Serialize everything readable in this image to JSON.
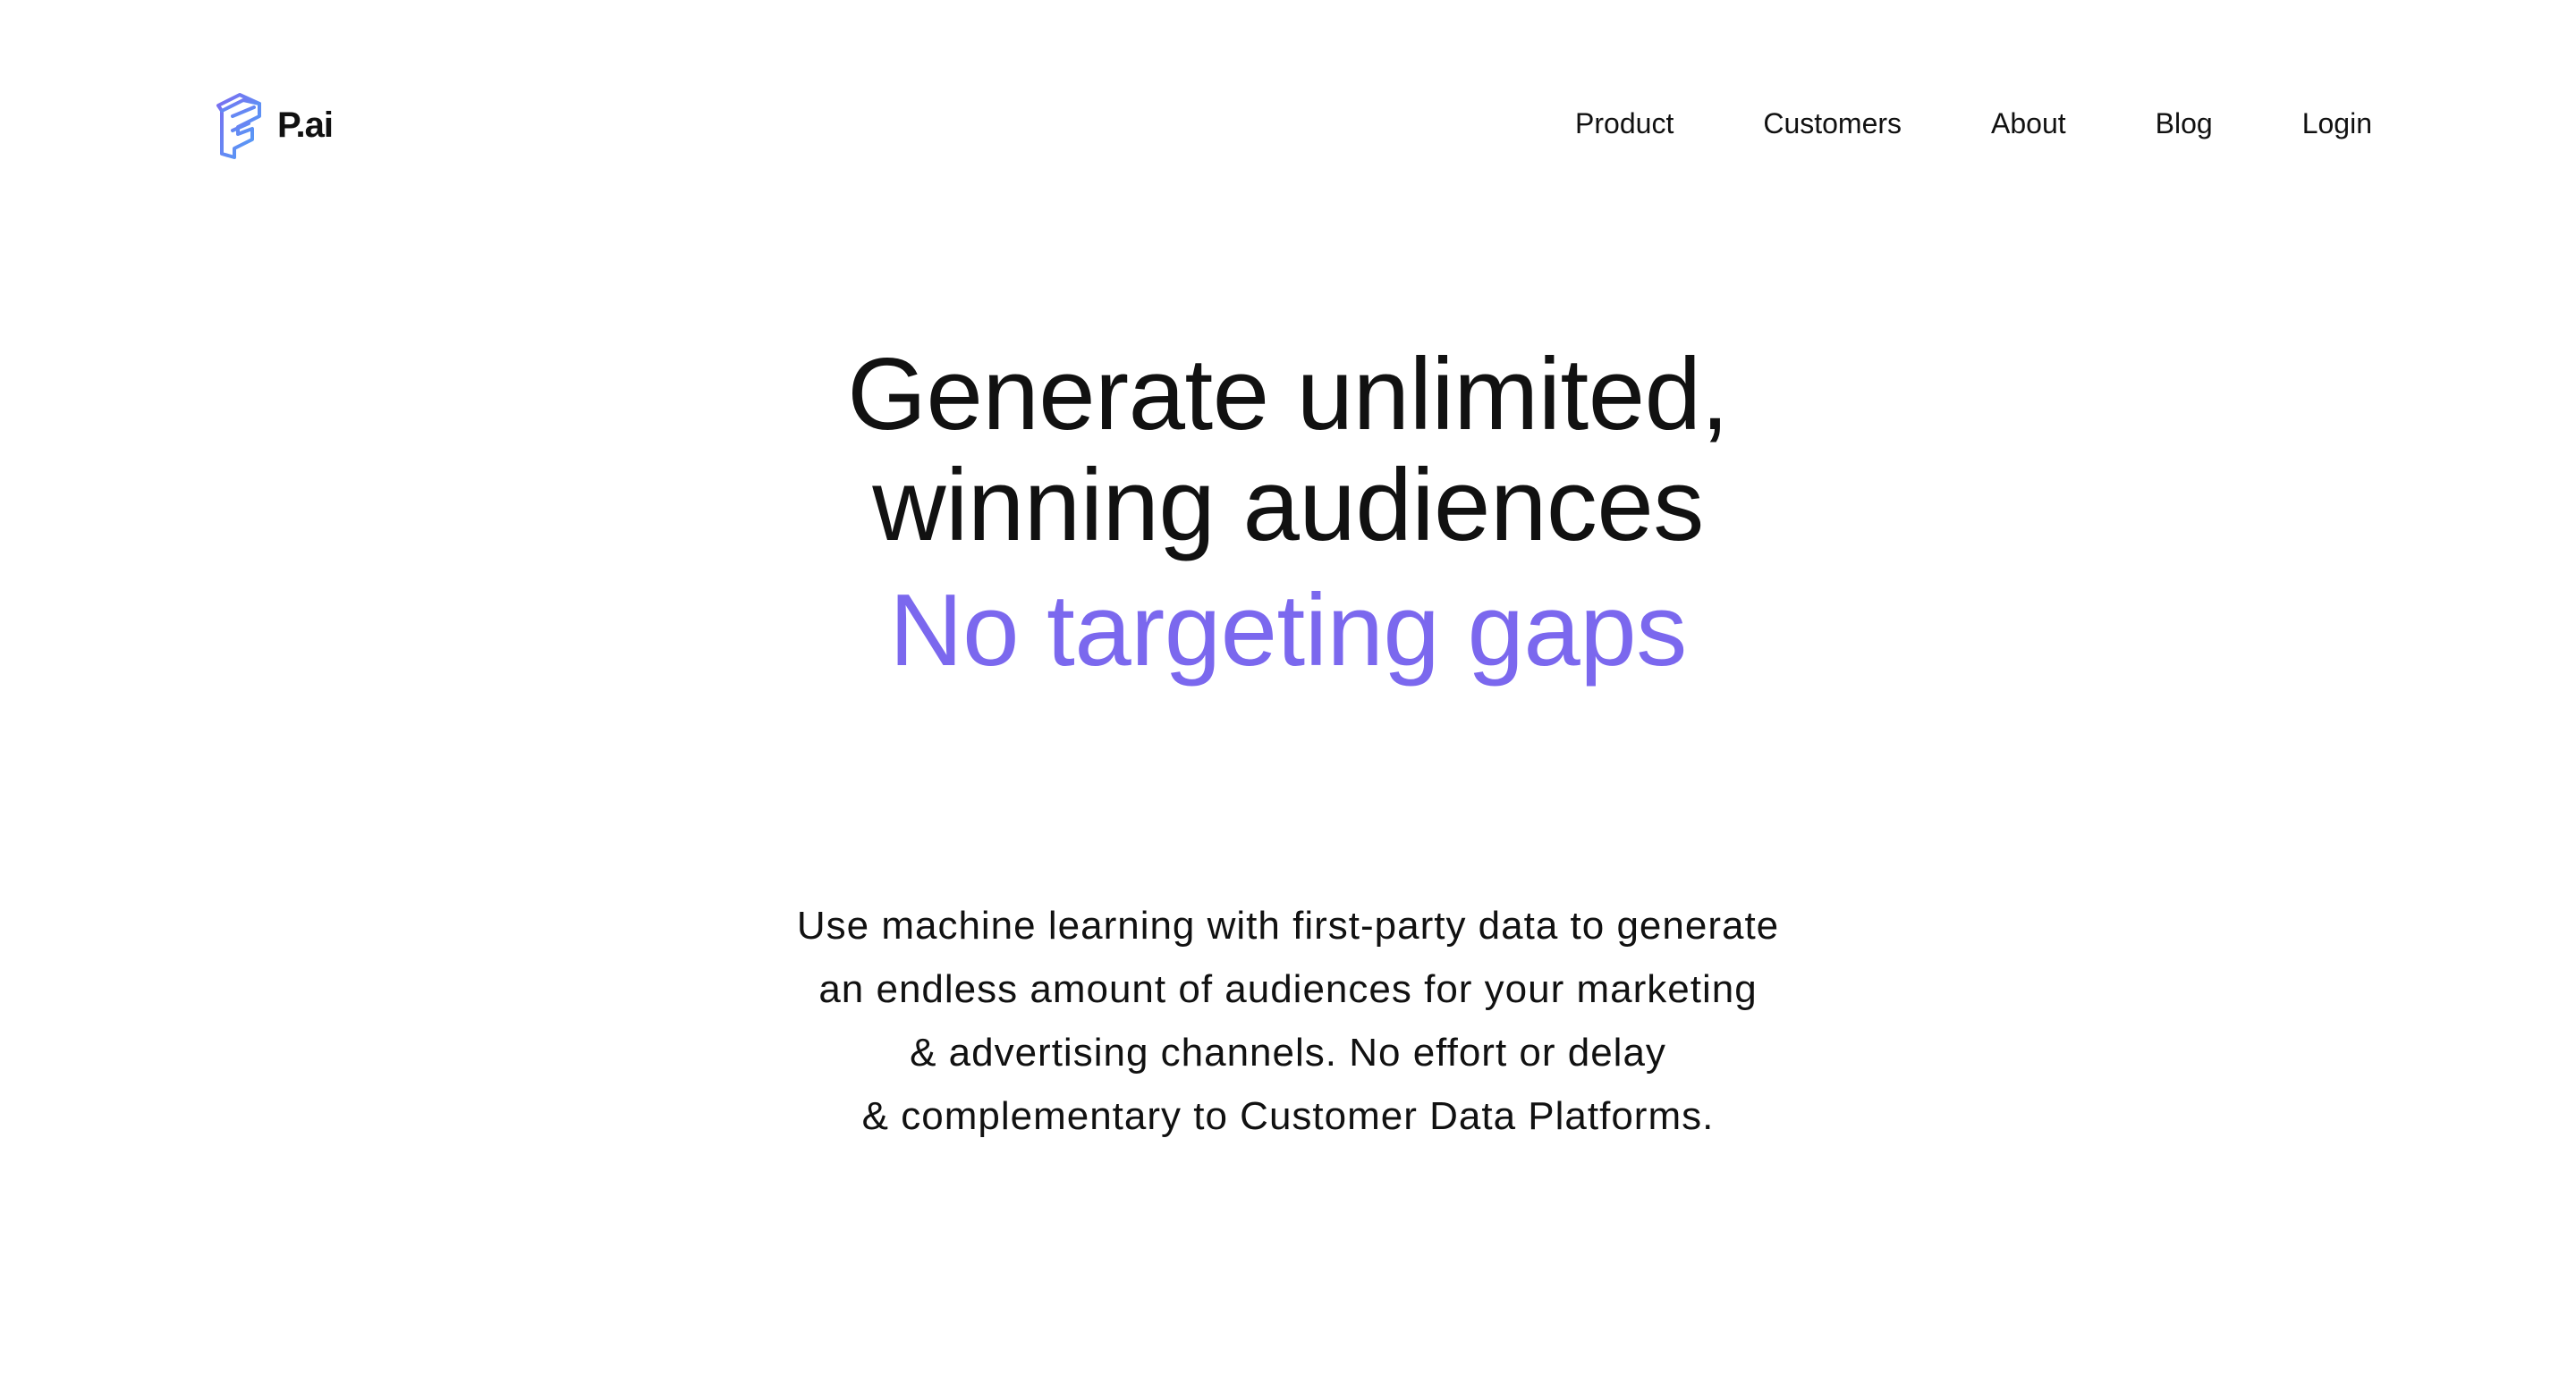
{
  "brand": {
    "name": "P.ai",
    "logo_icon": "pai-logo-icon",
    "logo_colors": [
      "#5a7cf5",
      "#7c6cf0",
      "#4fa3f7"
    ]
  },
  "nav": {
    "items": [
      {
        "label": "Product"
      },
      {
        "label": "Customers"
      },
      {
        "label": "About"
      },
      {
        "label": "Blog"
      },
      {
        "label": "Login"
      }
    ]
  },
  "hero": {
    "headline_line1": "Generate unlimited,",
    "headline_line2": "winning audiences",
    "accent_line": "No targeting gaps",
    "accent_color": "#7b68ee",
    "description_lines": [
      "Use machine learning with first-party data to generate",
      "an endless amount of audiences for your marketing",
      "& advertising channels. No effort or delay",
      "& complementary to Customer Data Platforms."
    ]
  }
}
